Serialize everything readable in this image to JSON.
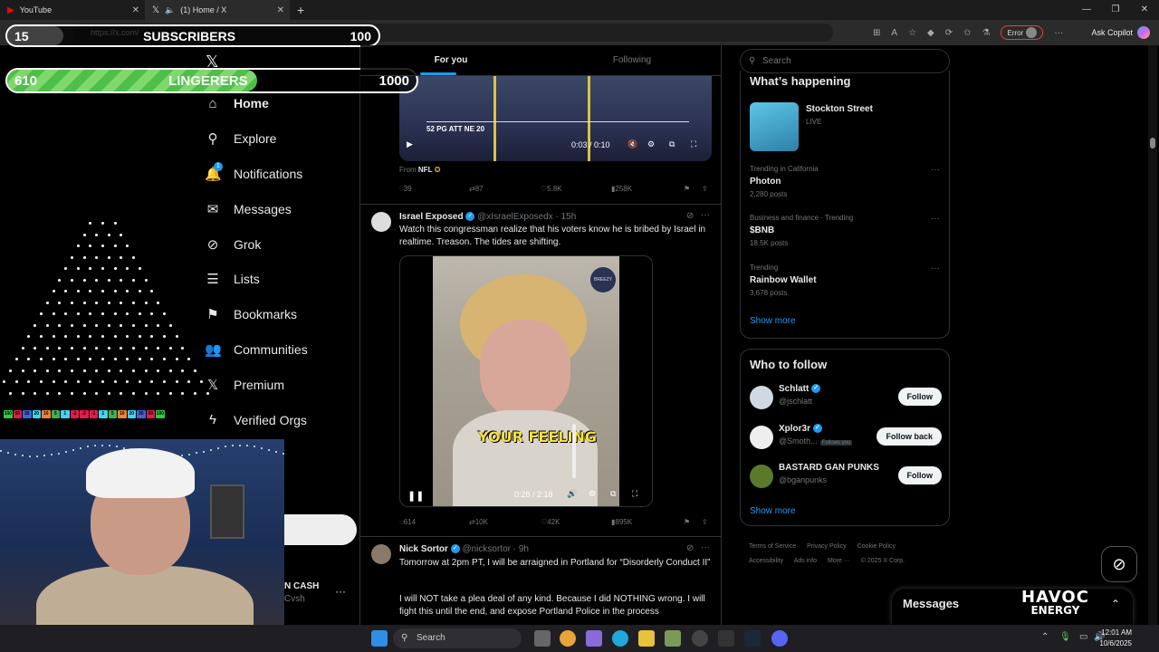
{
  "browser": {
    "tabs": [
      {
        "title": "YouTube",
        "active": false
      },
      {
        "title": "(1) Home / X",
        "active": true
      }
    ],
    "url": "https://x.com/",
    "error_label": "Error",
    "copilot_label": "Ask Copilot"
  },
  "overlay": {
    "subscribers": {
      "current": "15",
      "label": "SUBSCRIBERS",
      "goal": "100",
      "progress": 0.15
    },
    "lingerers": {
      "current": "610",
      "label": "LINGERERS",
      "goal": "1000",
      "progress": 0.61
    },
    "plinko_bins": [
      "100",
      "50",
      "35",
      "20",
      "10",
      "5",
      "1",
      "-1",
      "-2",
      "-1",
      "1",
      "5",
      "10",
      "20",
      "35",
      "50",
      "100"
    ],
    "plinko_colors": [
      "#2ecc40",
      "#e6194b",
      "#4363d8",
      "#42d4f4",
      "#f58231",
      "#3cb44b",
      "#42d4f4",
      "#e6194b",
      "#e6194b",
      "#e6194b",
      "#42d4f4",
      "#3cb44b",
      "#f58231",
      "#42d4f4",
      "#4363d8",
      "#e6194b",
      "#2ecc40"
    ]
  },
  "nav": {
    "items": [
      {
        "label": "Home",
        "icon": "home-icon",
        "glyph": "⌂"
      },
      {
        "label": "Explore",
        "icon": "search-icon",
        "glyph": "⚲"
      },
      {
        "label": "Notifications",
        "icon": "bell-icon",
        "glyph": "🔔"
      },
      {
        "label": "Messages",
        "icon": "envelope-icon",
        "glyph": "✉"
      },
      {
        "label": "Grok",
        "icon": "grok-icon",
        "glyph": "⊘"
      },
      {
        "label": "Lists",
        "icon": "list-icon",
        "glyph": "☰"
      },
      {
        "label": "Bookmarks",
        "icon": "bookmark-icon",
        "glyph": "⚑"
      },
      {
        "label": "Communities",
        "icon": "people-icon",
        "glyph": "👥"
      },
      {
        "label": "Premium",
        "icon": "x-icon",
        "glyph": "𝕏"
      },
      {
        "label": "Verified Orgs",
        "icon": "bolt-icon",
        "glyph": "ϟ"
      }
    ],
    "notification_count": "1"
  },
  "account": {
    "name": "N CASH",
    "handle": "Cvsh"
  },
  "feed": {
    "tabs": [
      "For you",
      "Following"
    ],
    "video1": {
      "time": "0:03 / 0:10",
      "source_label": "From",
      "source_name": "NFL",
      "scoreboard": "52 PG ATT   NE 20"
    },
    "post1_stats": {
      "replies": "39",
      "reposts": "87",
      "likes": "5.8K",
      "views": "258K"
    },
    "post2": {
      "name": "Israel Exposed",
      "handle": "@xIsraelExposedx",
      "time": "· 15h",
      "text": "Watch this congressman realize that his voters know he is bribed by Israel in realtime. Treason. The tides are shifting.",
      "video_time": "0:28 / 2:18",
      "caption": "YOUR FEELING",
      "logo": "BREEZY",
      "stats": {
        "replies": "614",
        "reposts": "10K",
        "likes": "42K",
        "views": "895K"
      }
    },
    "post3": {
      "name": "Nick Sortor",
      "handle": "@nicksortor",
      "time": "· 9h",
      "text1": "Tomorrow at 2pm PT, I will be arraigned in Portland for “Disorderly Conduct II”",
      "text2": "I will NOT take a plea deal of any kind. Because I did NOTHING wrong. I will fight this until the end, and expose Portland Police in the process"
    }
  },
  "right": {
    "search_placeholder": "Search",
    "happening_title": "What’s happening",
    "live_event": {
      "name": "Stockton Street",
      "status": "LIVE"
    },
    "trends": [
      {
        "meta": "Trending in California",
        "name": "Photon",
        "count": "2,280 posts"
      },
      {
        "meta": "Business and finance · Trending",
        "name": "$BNB",
        "count": "18.5K posts"
      },
      {
        "meta": "Trending",
        "name": "Rainbow Wallet",
        "count": "3,678 posts"
      }
    ],
    "show_more": "Show more",
    "wtf_title": "Who to follow",
    "wtf": [
      {
        "name": "Schlatt",
        "handle": "@jschlatt",
        "button": "Follow",
        "follows_you": false
      },
      {
        "name": "Xplor3r",
        "handle": "@Smoth...",
        "button": "Follow back",
        "follows_you": true,
        "follows_you_label": "Follows you"
      },
      {
        "name": "BASTARD GAN PUNKS",
        "handle": "@bganpunks",
        "button": "Follow",
        "follows_you": false
      }
    ],
    "footer": [
      "Terms of Service",
      "Privacy Policy",
      "Cookie Policy",
      "Accessibility",
      "Ads info",
      "More ···",
      "© 2025 X Corp."
    ],
    "messages_label": "Messages",
    "brand_line1": "HAVOC",
    "brand_line2": "ENERGY"
  },
  "taskbar": {
    "search_label": "Search",
    "time": "12:01 AM",
    "date": "10/6/2025"
  },
  "colors": {
    "accent": "#1d9bf0",
    "bg": "#000000",
    "border": "#2f3336",
    "muted": "#71767b"
  }
}
